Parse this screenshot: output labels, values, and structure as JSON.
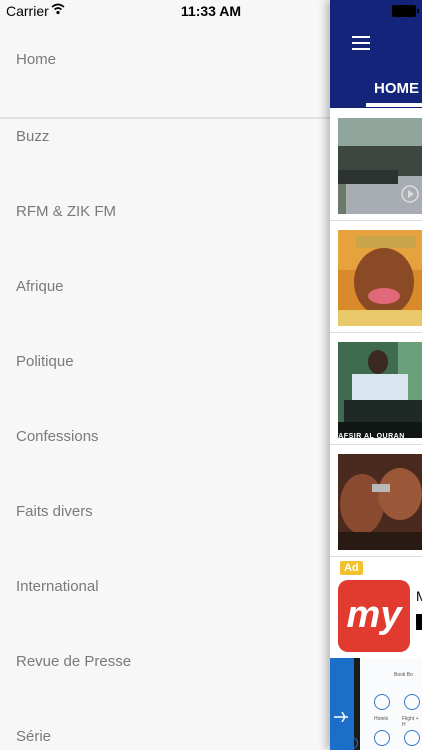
{
  "status_bar": {
    "carrier": "Carrier",
    "time": "11:33 AM"
  },
  "menu": {
    "items": [
      {
        "label": "Home"
      },
      {
        "label": "Buzz"
      },
      {
        "label": "RFM & ZIK FM"
      },
      {
        "label": "Afrique"
      },
      {
        "label": "Politique"
      },
      {
        "label": "Confessions"
      },
      {
        "label": "Faits divers"
      },
      {
        "label": "International"
      },
      {
        "label": "Revue de Presse"
      },
      {
        "label": "Série"
      }
    ]
  },
  "main": {
    "tab": "HOME",
    "thumb_caption": "TAFSIR AL QURAN",
    "ad": {
      "badge": "Ad",
      "logo_text": "my",
      "title": "M",
      "banner": {
        "hotels": "Hotels",
        "flight": "Flight + H",
        "top_text": "Book Bo",
        "close": "✕",
        "info": "i"
      }
    }
  },
  "colors": {
    "nav": "#14247a",
    "menu_text": "#7a7a7a",
    "ad_badge": "#f2c12e",
    "ad_logo": "#e13a2e"
  }
}
